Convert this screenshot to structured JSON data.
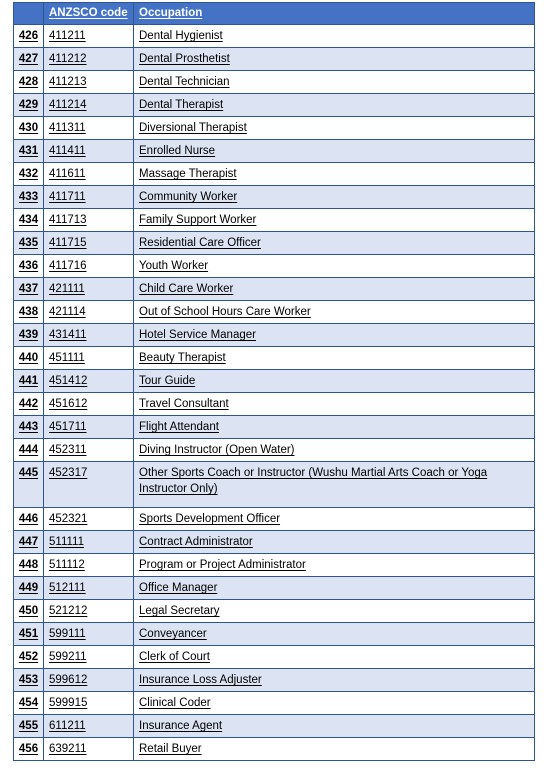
{
  "table": {
    "columns": [
      {
        "key": "index",
        "label": ""
      },
      {
        "key": "code",
        "label": "ANZSCO code"
      },
      {
        "key": "occupation",
        "label": "Occupation"
      }
    ],
    "header": {
      "col1_label": "",
      "col2_label": "ANZSCO code",
      "col3_label": "Occupation"
    },
    "colors": {
      "header_background": "#4472c4",
      "header_text": "#ffffff",
      "border": "#2f5496",
      "row_alt_background": "#dce3f2",
      "row_background": "#ffffff",
      "text": "#000000"
    },
    "rows": [
      {
        "index": "426",
        "code": "411211",
        "occupation": "Dental Hygienist"
      },
      {
        "index": "427",
        "code": "411212",
        "occupation": "Dental Prosthetist"
      },
      {
        "index": "428",
        "code": "411213",
        "occupation": "Dental Technician"
      },
      {
        "index": "429",
        "code": "411214",
        "occupation": "Dental Therapist"
      },
      {
        "index": "430",
        "code": "411311",
        "occupation": "Diversional Therapist"
      },
      {
        "index": "431",
        "code": "411411",
        "occupation": "Enrolled Nurse"
      },
      {
        "index": "432",
        "code": "411611",
        "occupation": "Massage Therapist"
      },
      {
        "index": "433",
        "code": "411711",
        "occupation": "Community Worker"
      },
      {
        "index": "434",
        "code": "411713",
        "occupation": "Family Support Worker"
      },
      {
        "index": "435",
        "code": "411715",
        "occupation": "Residential Care Officer"
      },
      {
        "index": "436",
        "code": "411716",
        "occupation": "Youth Worker"
      },
      {
        "index": "437",
        "code": "421111",
        "occupation": "Child Care Worker"
      },
      {
        "index": "438",
        "code": "421114",
        "occupation": "Out of School Hours Care Worker"
      },
      {
        "index": "439",
        "code": "431411",
        "occupation": "Hotel Service Manager"
      },
      {
        "index": "440",
        "code": "451111",
        "occupation": "Beauty Therapist"
      },
      {
        "index": "441",
        "code": "451412",
        "occupation": "Tour Guide"
      },
      {
        "index": "442",
        "code": "451612",
        "occupation": "Travel Consultant"
      },
      {
        "index": "443",
        "code": "451711",
        "occupation": "Flight Attendant"
      },
      {
        "index": "444",
        "code": "452311",
        "occupation": "Diving Instructor (Open Water)"
      },
      {
        "index": "445",
        "code": "452317",
        "occupation": "Other Sports Coach or Instructor (Wushu Martial Arts Coach or Yoga Instructor Only)"
      },
      {
        "index": "446",
        "code": "452321",
        "occupation": "Sports Development Officer"
      },
      {
        "index": "447",
        "code": "511111",
        "occupation": "Contract Administrator"
      },
      {
        "index": "448",
        "code": "511112",
        "occupation": "Program or Project Administrator"
      },
      {
        "index": "449",
        "code": "512111",
        "occupation": "Office Manager"
      },
      {
        "index": "450",
        "code": "521212",
        "occupation": "Legal Secretary"
      },
      {
        "index": "451",
        "code": "599111",
        "occupation": "Conveyancer"
      },
      {
        "index": "452",
        "code": "599211",
        "occupation": "Clerk of Court"
      },
      {
        "index": "453",
        "code": "599612",
        "occupation": "Insurance Loss Adjuster"
      },
      {
        "index": "454",
        "code": "599915",
        "occupation": "Clinical Coder"
      },
      {
        "index": "455",
        "code": "611211",
        "occupation": "Insurance Agent"
      },
      {
        "index": "456",
        "code": "639211",
        "occupation": "Retail Buyer"
      }
    ]
  }
}
